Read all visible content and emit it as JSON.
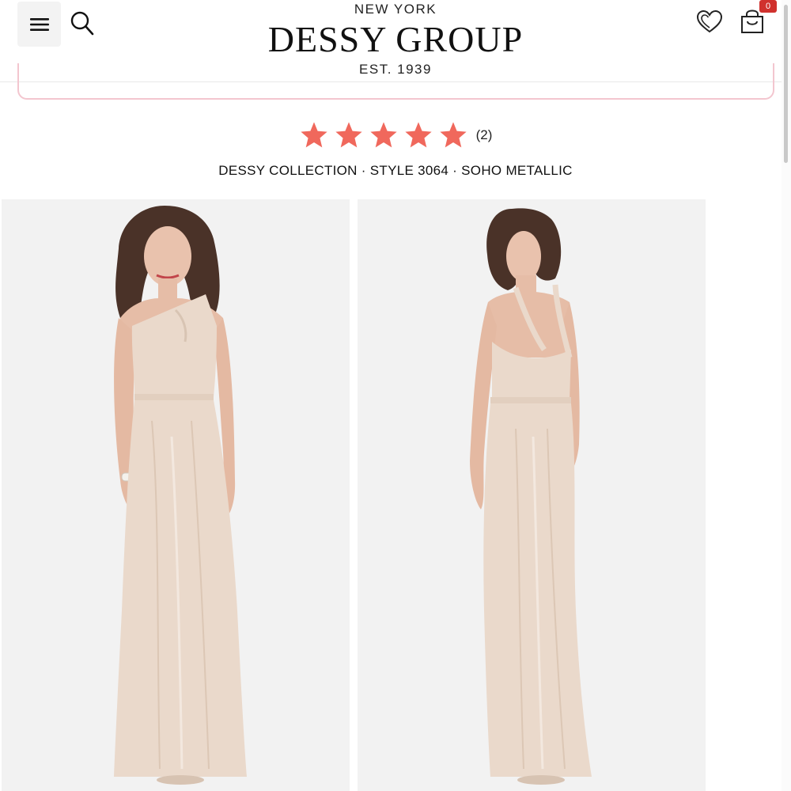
{
  "header": {
    "brand_top": "NEW YORK",
    "brand_name": "DESSY GROUP",
    "brand_bottom": "EST. 1939",
    "cart_count": "0",
    "icons": {
      "menu": "hamburger-menu-icon",
      "search": "search-icon",
      "wishlist": "heart-icon",
      "cart": "shopping-bag-icon"
    }
  },
  "product": {
    "rating_stars": 5,
    "review_count": "(2)",
    "title": "DESSY COLLECTION · STYLE 3064 · SOHO METALLIC"
  },
  "colors": {
    "star": "#f0685c",
    "badge": "#d0312d",
    "promo_border": "#f3c6cf",
    "photo_bg": "#f2f2f2",
    "gown": "#ead9cb"
  }
}
